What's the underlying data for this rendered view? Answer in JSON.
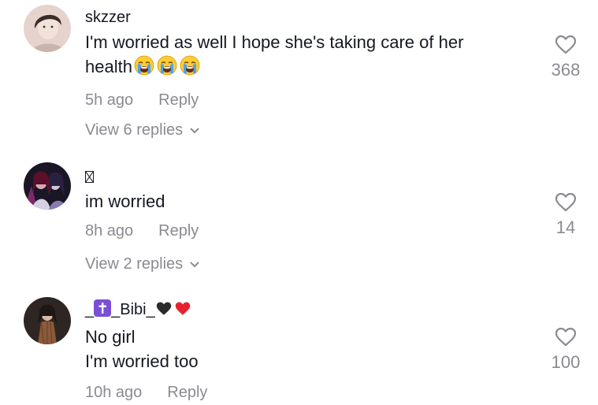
{
  "comments": [
    {
      "username": "skzzer",
      "text_line1": "I'm worried as well I hope she's taking care of her",
      "text_line2": "health",
      "emoji_names": [
        "loudly-crying-face",
        "loudly-crying-face",
        "loudly-crying-face"
      ],
      "time": "5h ago",
      "reply_label": "Reply",
      "view_replies": "View 6 replies",
      "likes": "368"
    },
    {
      "username_glyph": "missing-glyph",
      "text_line1": "im worried",
      "time": "8h ago",
      "reply_label": "Reply",
      "view_replies": "View 2 replies",
      "likes": "14"
    },
    {
      "username_prefix": "_",
      "username_badge": "latin-cross-emoji",
      "username_mid": "_Bibi_",
      "username_emojis": [
        "black-heart",
        "red-heart"
      ],
      "text_line1": "No girl",
      "text_line2": "I'm worried too",
      "time": "10h ago",
      "reply_label": "Reply",
      "likes": "100"
    }
  ],
  "colors": {
    "text": "#161823",
    "secondary": "#8a8b91",
    "badge": "#7a4fd6",
    "red_heart": "#e8212e"
  }
}
